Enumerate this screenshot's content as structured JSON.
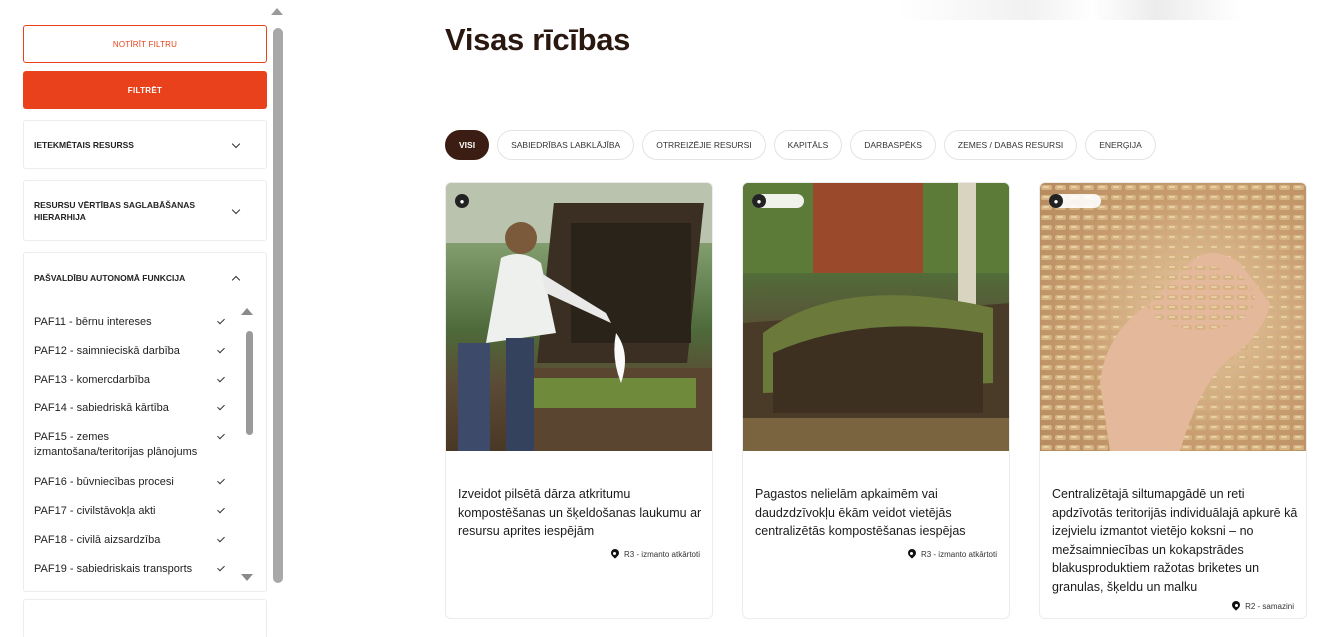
{
  "sidebar": {
    "clear_button": "NOTĪRĪT FILTRU",
    "filter_button": "FILTRĒT",
    "accordions": [
      {
        "label": "IETEKMĒTAIS RESURSS",
        "expanded": false
      },
      {
        "label": "RESURSU VĒRTĪBAS SAGLABĀŠANAS HIERARHIJA",
        "expanded": false
      },
      {
        "label": "PAŠVALDĪBU AUTONOMĀ FUNKCIJA",
        "expanded": true
      }
    ],
    "options": [
      {
        "label": "PAF11 - bērnu intereses",
        "checked": true
      },
      {
        "label": "PAF12 - saimnieciskā darbība",
        "checked": true
      },
      {
        "label": "PAF13 - komercdarbība",
        "checked": true
      },
      {
        "label": "PAF14 - sabiedriskā kārtība",
        "checked": true
      },
      {
        "label": "PAF15 - zemes izmantošana/teritorijas plānojums",
        "checked": true
      },
      {
        "label": "PAF16 - būvniecības procesi",
        "checked": true
      },
      {
        "label": "PAF17 - civilstāvokļa akti",
        "checked": true
      },
      {
        "label": "PAF18 - civilā aizsardzība",
        "checked": true
      },
      {
        "label": "PAF19 - sabiedriskais transports",
        "checked": true
      }
    ]
  },
  "main": {
    "title": "Visas rīcības",
    "tabs": [
      {
        "label": "VISI",
        "active": true
      },
      {
        "label": "SABIEDRĪBAS LABKLĀJĪBA"
      },
      {
        "label": "OTRREIZĒJIE RESURSI"
      },
      {
        "label": "KAPITĀLS"
      },
      {
        "label": "DARBASPĒKS"
      },
      {
        "label": "ZEMES / DABAS RESURSI"
      },
      {
        "label": "ENERĢIJA"
      }
    ],
    "cards": [
      {
        "title": "Izveidot pilsētā dārza atkritumu kompostēšanas un šķeldošanas laukumu ar resursu aprites iespējām",
        "tag": "R3 - izmanto atkārtoti",
        "image": "composting-woman-photo"
      },
      {
        "title": "Pagastos nelielām apkaimēm vai daudzdzīvokļu ēkām veidot vietējās centralizētās kompostēšanas iespējas",
        "tag": "R3 - izmanto atkārtoti",
        "image": "compost-heap-photo"
      },
      {
        "title": "Centralizētajā siltumapgādē un reti apdzīvotās teritorijās individuālajā apkurē kā izejvielu izmantot vietējo koksni – no mežsaimniecības un kokapstrādes blakusproduktiem ražotas briketes un granulas, šķeldu un malku",
        "tag": "R2 - samazini",
        "image": "wood-pellets-hand-photo"
      }
    ],
    "accent_color": "#e8411b",
    "dark_color": "#3b1d13"
  }
}
